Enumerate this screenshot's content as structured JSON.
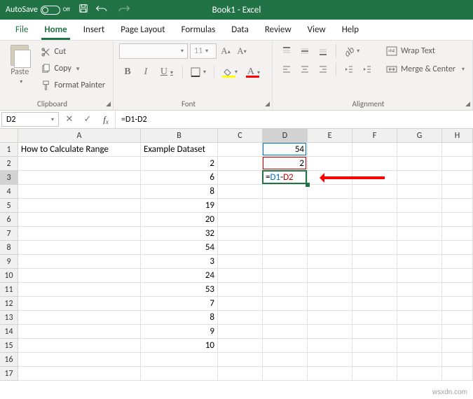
{
  "title_bar": {
    "autosave_label": "AutoSave",
    "autosave_state": "Off",
    "document_title": "Book1 - Excel"
  },
  "tabs": {
    "file": "File",
    "home": "Home",
    "insert": "Insert",
    "page_layout": "Page Layout",
    "formulas": "Formulas",
    "data": "Data",
    "review": "Review",
    "view": "View",
    "help": "Help"
  },
  "ribbon": {
    "clipboard": {
      "paste": "Paste",
      "cut": "Cut",
      "copy": "Copy",
      "format_painter": "Format Painter",
      "group_label": "Clipboard"
    },
    "font": {
      "group_label": "Font",
      "size": "11"
    },
    "alignment": {
      "group_label": "Alignment",
      "wrap": "Wrap Text",
      "merge": "Merge & Center"
    }
  },
  "name_box": "D2",
  "formula_bar": "=D1-D2",
  "columns": [
    {
      "id": "A",
      "w": 175
    },
    {
      "id": "B",
      "w": 110
    },
    {
      "id": "C",
      "w": 64
    },
    {
      "id": "D",
      "w": 64
    },
    {
      "id": "E",
      "w": 64
    },
    {
      "id": "F",
      "w": 64
    },
    {
      "id": "G",
      "w": 64
    },
    {
      "id": "H",
      "w": 44
    }
  ],
  "row_count": 17,
  "cells": {
    "A1": "How to Calculate Range",
    "B1": "Example Dataset",
    "D1": "54",
    "B2": "2",
    "D2": "2",
    "B3": "6",
    "B4": "8",
    "B5": "19",
    "B6": "20",
    "B7": "32",
    "B8": "54",
    "B9": "3",
    "B10": "24",
    "B11": "53",
    "B12": "7",
    "B13": "8",
    "B14": "9",
    "B15": "10"
  },
  "editing_cell": {
    "addr": "D3",
    "text_prefix": "=",
    "text_ref1": "D1",
    "text_op": "-",
    "text_ref2": "D2"
  },
  "selected_column": "D",
  "selected_row": 3,
  "watermark": "wsxdn.com"
}
